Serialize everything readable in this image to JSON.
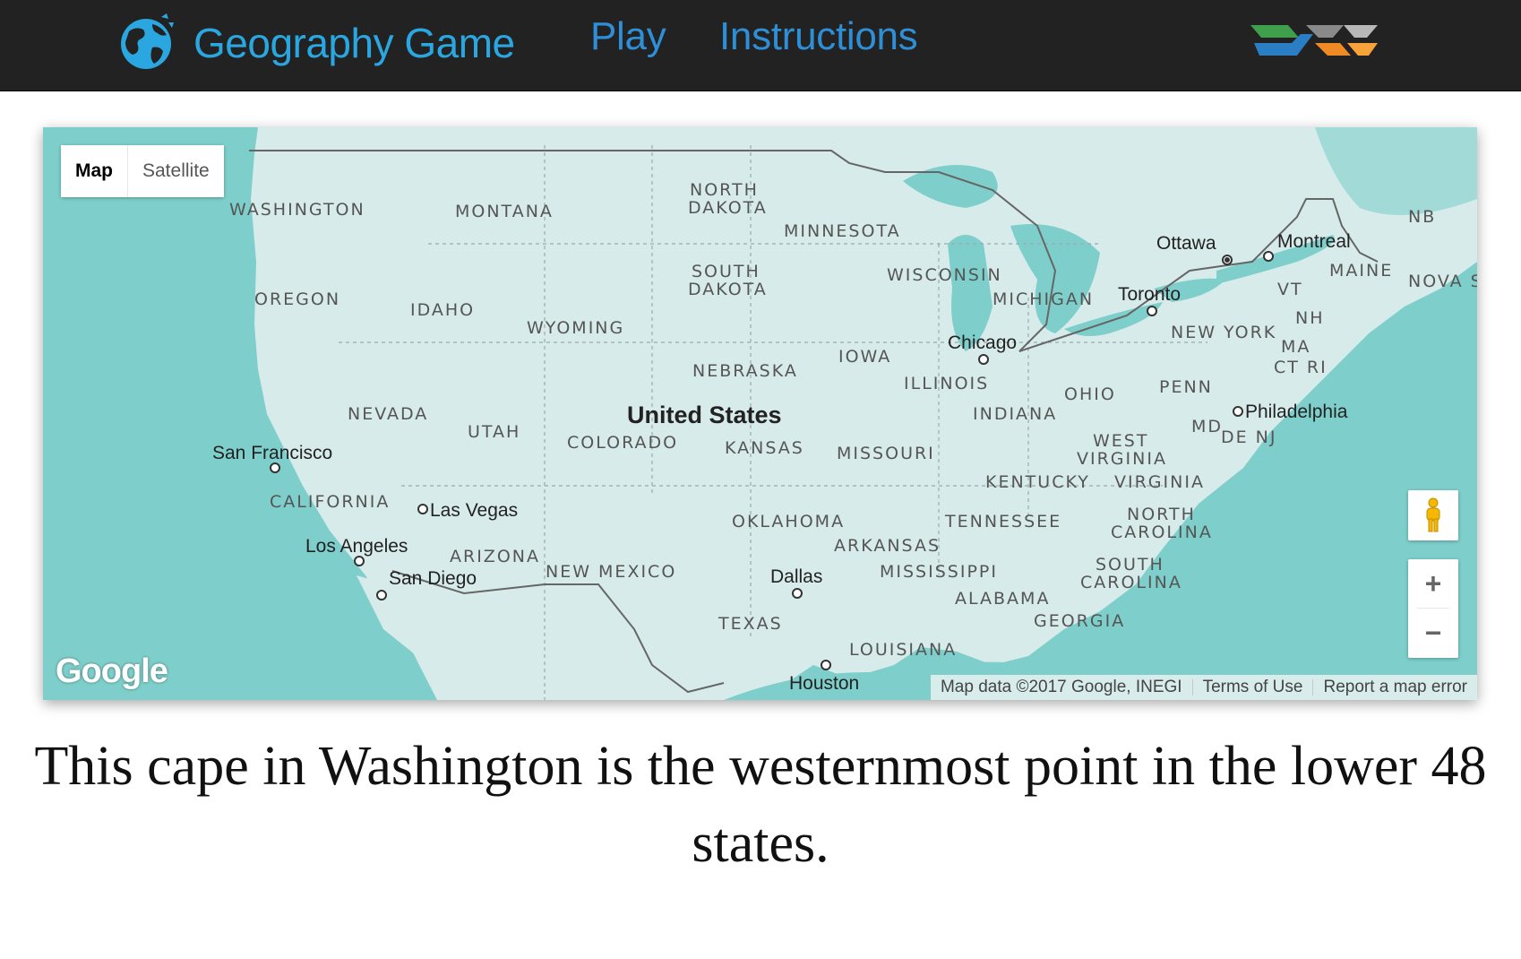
{
  "navbar": {
    "brand": "Geography Game",
    "brand_icon": "globe-icon",
    "links": [
      "Play",
      "Instructions"
    ],
    "partner_logo": "partner-logo",
    "colors": {
      "background": "#222222",
      "brand": "#2aa7e0",
      "link": "#2f8fd6"
    }
  },
  "map": {
    "map_type_options": [
      "Map",
      "Satellite"
    ],
    "selected_map_type": "Map",
    "country_label": "United States",
    "states": [
      "WASHINGTON",
      "MONTANA",
      "NORTH",
      "DAKOTA",
      "MINNESOTA",
      "SOUTH",
      "DAKOTA",
      "OREGON",
      "IDAHO",
      "WYOMING",
      "WISCONSIN",
      "MICHIGAN",
      "NEBRASKA",
      "IOWA",
      "ILLINOIS",
      "NEVADA",
      "UTAH",
      "COLORADO",
      "KANSAS",
      "MISSOURI",
      "INDIANA",
      "OHIO",
      "PENN",
      "WEST",
      "VIRGINIA",
      "KENTUCKY",
      "VIRGINIA",
      "CALIFORNIA",
      "OKLAHOMA",
      "TENNESSEE",
      "NORTH",
      "CAROLINA",
      "ARKANSAS",
      "ARIZONA",
      "NEW MEXICO",
      "MISSISSIPPI",
      "SOUTH",
      "CAROLINA",
      "ALABAMA",
      "GEORGIA",
      "TEXAS",
      "LOUISIANA",
      "NEW YORK",
      "VT",
      "NH",
      "MA",
      "CT RI",
      "MD",
      "DE NJ",
      "MAINE",
      "NB",
      "NOVA S"
    ],
    "cities": [
      "Ottawa",
      "Montreal",
      "Toronto",
      "Chicago",
      "Philadelphia",
      "San Francisco",
      "Las Vegas",
      "Los Angeles",
      "San Diego",
      "Dallas",
      "Houston"
    ],
    "pegman_icon": "pegman-icon",
    "zoom_in": "+",
    "zoom_out": "−",
    "google_logo": "Google",
    "attribution": {
      "data": "Map data ©2017 Google, INEGI",
      "terms": "Terms of Use",
      "report": "Report a map error"
    },
    "colors": {
      "water": "#7ecfcb",
      "land": "#d7ebea"
    }
  },
  "question": {
    "text": "This cape in Washington is the westernmost point in the lower 48 states."
  }
}
